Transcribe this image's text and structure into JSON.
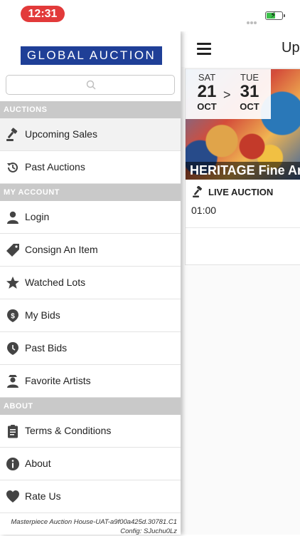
{
  "status_bar": {
    "time": "12:31",
    "battery_level": 0.6
  },
  "main": {
    "title": "Up",
    "card": {
      "start_day": "SAT",
      "start_date": "21",
      "start_month": "OCT",
      "arrow": ">",
      "end_day": "TUE",
      "end_date": "31",
      "end_month": "OCT",
      "title": "HERITAGE Fine Art",
      "live_label": "LIVE AUCTION",
      "time": "01:00"
    }
  },
  "drawer": {
    "logo": "GLOBAL AUCTION",
    "search_placeholder": "",
    "sections": [
      {
        "header": "AUCTIONS",
        "items": [
          {
            "label": "Upcoming Sales",
            "icon": "gavel-icon"
          },
          {
            "label": "Past Auctions",
            "icon": "history-icon"
          }
        ]
      },
      {
        "header": "MY ACCOUNT",
        "items": [
          {
            "label": "Login",
            "icon": "user-icon"
          },
          {
            "label": "Consign An Item",
            "icon": "tag-icon"
          },
          {
            "label": "Watched Lots",
            "icon": "star-icon"
          },
          {
            "label": "My Bids",
            "icon": "dollar-icon"
          },
          {
            "label": "Past Bids",
            "icon": "pin-icon"
          },
          {
            "label": "Favorite Artists",
            "icon": "artist-icon"
          }
        ]
      },
      {
        "header": "ABOUT",
        "items": [
          {
            "label": "Terms & Conditions",
            "icon": "clipboard-icon"
          },
          {
            "label": "About",
            "icon": "info-icon"
          },
          {
            "label": "Rate Us",
            "icon": "heart-icon"
          }
        ]
      }
    ],
    "footer_line1": "Masterpiece Auction House-UAT-a9f00a425d.30781.C1",
    "footer_line2": "Config: SJuchu0Lz"
  },
  "colors": {
    "logo_bg": "#1f3f97",
    "time_pill": "#e23a3a",
    "section_header": "#c9c9c9",
    "battery": "#3cc14a"
  }
}
